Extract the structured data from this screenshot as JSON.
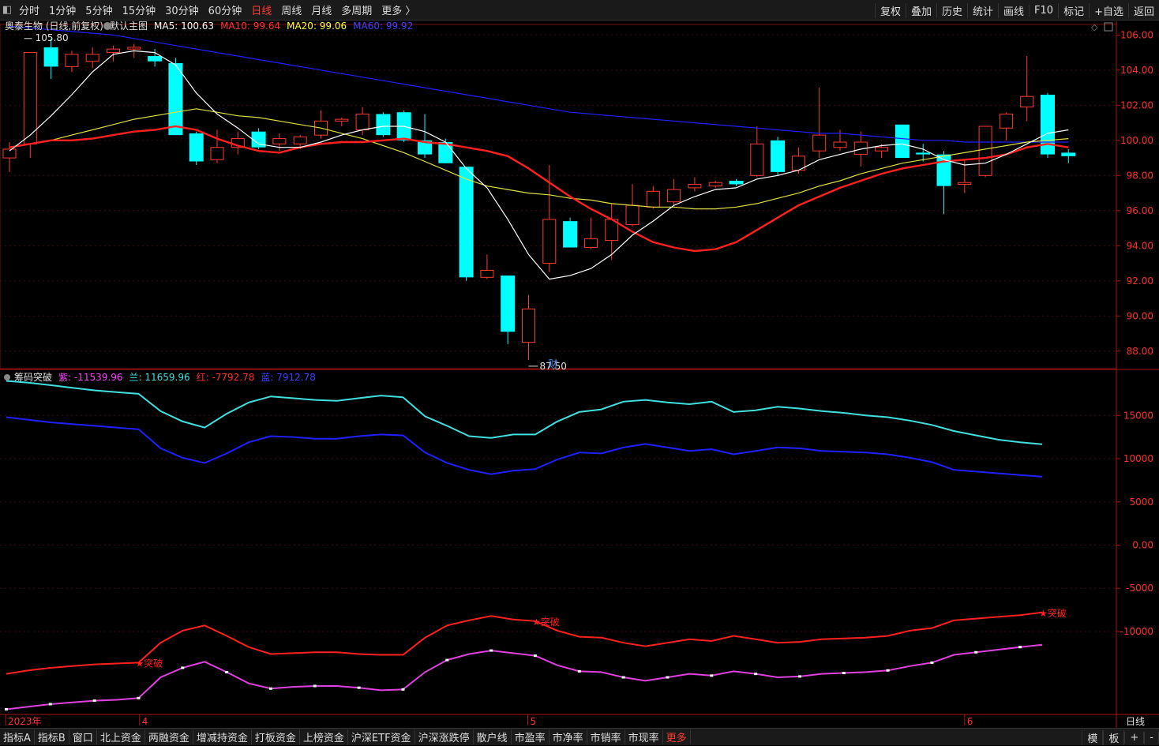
{
  "toolbar": {
    "periods": [
      "分时",
      "1分钟",
      "5分钟",
      "15分钟",
      "30分钟",
      "60分钟",
      "日线",
      "周线",
      "月线",
      "多周期",
      "更多 〉"
    ],
    "active_index": 6,
    "right_buttons": [
      "复权",
      "叠加",
      "历史",
      "统计",
      "画线",
      "F10",
      "标记",
      "+自选",
      "返回"
    ]
  },
  "main_legend": {
    "stock": "奥泰生物 (日线,前复权)",
    "template": "默认主图",
    "ma5": "MA5: 100.63",
    "ma10": "MA10: 99.64",
    "ma20": "MA20: 99.06",
    "ma60": "MA60: 99.92"
  },
  "sub_legend": {
    "name": "筹码突破",
    "purple": "紫: -11539.96",
    "blue": "兰: 11659.96",
    "red": "红: -7792.78",
    "darkblue": "蓝: 7912.78"
  },
  "annotations": {
    "high": "105.80",
    "low": "87.50",
    "cai": "财",
    "breakout": "★突破"
  },
  "time_axis": {
    "year": "2023年",
    "m4": "4",
    "m5": "5",
    "m6": "6",
    "period": "日线"
  },
  "colors": {
    "up": "#ff3b30",
    "down": "#00ffff",
    "ma5": "#ffffff",
    "ma10": "#ff2020",
    "ma20": "#e0e040",
    "ma60": "#2020ff"
  },
  "bottom_tabs": [
    "指标A",
    "指标B",
    "窗口",
    "北上资金",
    "两融资金",
    "增减持资金",
    "打板资金",
    "上榜资金",
    "沪深ETF资金",
    "沪深涨跌停",
    "散户线",
    "市盈率",
    "市净率",
    "市销率",
    "市现率",
    "更多"
  ],
  "bottom_right": [
    "模",
    "板",
    "+",
    "-"
  ],
  "chart_data": [
    {
      "type": "candlestick",
      "title": "奥泰生物 (日线,前复权)",
      "y_ticks": [
        106,
        104,
        102,
        100,
        98,
        96,
        94,
        92,
        90,
        88
      ],
      "ylim": [
        87.0,
        106.6
      ],
      "candles": [
        {
          "o": 99.0,
          "h": 99.9,
          "l": 98.2,
          "c": 99.5
        },
        {
          "o": 99.8,
          "h": 105.0,
          "l": 99.0,
          "c": 105.0
        },
        {
          "o": 105.3,
          "h": 105.8,
          "l": 103.5,
          "c": 104.2
        },
        {
          "o": 104.2,
          "h": 105.1,
          "l": 103.9,
          "c": 104.9
        },
        {
          "o": 104.5,
          "h": 105.3,
          "l": 104.1,
          "c": 104.9
        },
        {
          "o": 105.0,
          "h": 105.4,
          "l": 104.5,
          "c": 105.2
        },
        {
          "o": 105.2,
          "h": 105.5,
          "l": 104.7,
          "c": 105.3
        },
        {
          "o": 104.8,
          "h": 105.2,
          "l": 104.2,
          "c": 104.5
        },
        {
          "o": 104.4,
          "h": 104.7,
          "l": 100.3,
          "c": 100.3
        },
        {
          "o": 100.4,
          "h": 100.5,
          "l": 98.6,
          "c": 98.8
        },
        {
          "o": 98.9,
          "h": 100.6,
          "l": 98.7,
          "c": 99.6
        },
        {
          "o": 99.6,
          "h": 100.5,
          "l": 99.2,
          "c": 100.1
        },
        {
          "o": 100.5,
          "h": 100.7,
          "l": 99.5,
          "c": 99.6
        },
        {
          "o": 99.8,
          "h": 100.4,
          "l": 99.4,
          "c": 100.1
        },
        {
          "o": 99.8,
          "h": 100.3,
          "l": 99.5,
          "c": 100.2
        },
        {
          "o": 100.3,
          "h": 101.7,
          "l": 100.1,
          "c": 101.1
        },
        {
          "o": 101.1,
          "h": 101.3,
          "l": 100.8,
          "c": 101.2
        },
        {
          "o": 100.6,
          "h": 101.9,
          "l": 100.3,
          "c": 101.5
        },
        {
          "o": 101.5,
          "h": 101.6,
          "l": 100.2,
          "c": 100.3
        },
        {
          "o": 101.6,
          "h": 101.7,
          "l": 99.9,
          "c": 100.0
        },
        {
          "o": 100.0,
          "h": 101.5,
          "l": 99.0,
          "c": 99.2
        },
        {
          "o": 99.9,
          "h": 100.1,
          "l": 98.7,
          "c": 98.7
        },
        {
          "o": 98.5,
          "h": 98.5,
          "l": 92.0,
          "c": 92.2
        },
        {
          "o": 92.2,
          "h": 93.5,
          "l": 92.1,
          "c": 92.6
        },
        {
          "o": 92.3,
          "h": 92.3,
          "l": 88.4,
          "c": 89.1
        },
        {
          "o": 88.5,
          "h": 91.2,
          "l": 87.5,
          "c": 90.4
        },
        {
          "o": 93.0,
          "h": 98.6,
          "l": 92.5,
          "c": 95.5
        },
        {
          "o": 95.4,
          "h": 95.6,
          "l": 93.9,
          "c": 93.9
        },
        {
          "o": 93.9,
          "h": 95.6,
          "l": 93.8,
          "c": 94.4
        },
        {
          "o": 94.3,
          "h": 96.4,
          "l": 93.2,
          "c": 95.5
        },
        {
          "o": 95.2,
          "h": 97.5,
          "l": 95.1,
          "c": 96.3
        },
        {
          "o": 96.2,
          "h": 97.4,
          "l": 96.1,
          "c": 97.1
        },
        {
          "o": 96.5,
          "h": 97.8,
          "l": 96.3,
          "c": 97.2
        },
        {
          "o": 97.3,
          "h": 97.9,
          "l": 97.1,
          "c": 97.5
        },
        {
          "o": 97.4,
          "h": 97.7,
          "l": 97.3,
          "c": 97.6
        },
        {
          "o": 97.7,
          "h": 97.8,
          "l": 97.4,
          "c": 97.5
        },
        {
          "o": 98.0,
          "h": 100.8,
          "l": 97.9,
          "c": 99.8
        },
        {
          "o": 100.0,
          "h": 100.2,
          "l": 98.0,
          "c": 98.2
        },
        {
          "o": 98.3,
          "h": 99.6,
          "l": 98.1,
          "c": 99.1
        },
        {
          "o": 99.4,
          "h": 103.0,
          "l": 99.0,
          "c": 100.3
        },
        {
          "o": 99.6,
          "h": 100.6,
          "l": 99.4,
          "c": 99.9
        },
        {
          "o": 99.2,
          "h": 100.5,
          "l": 98.5,
          "c": 99.9
        },
        {
          "o": 99.4,
          "h": 99.8,
          "l": 99.0,
          "c": 99.6
        },
        {
          "o": 100.9,
          "h": 100.9,
          "l": 99.0,
          "c": 99.0
        },
        {
          "o": 99.3,
          "h": 99.8,
          "l": 98.8,
          "c": 99.2
        },
        {
          "o": 99.2,
          "h": 99.4,
          "l": 95.8,
          "c": 97.4
        },
        {
          "o": 97.5,
          "h": 98.9,
          "l": 97.0,
          "c": 97.6
        },
        {
          "o": 98.0,
          "h": 100.8,
          "l": 97.9,
          "c": 100.8
        },
        {
          "o": 100.7,
          "h": 101.6,
          "l": 100.0,
          "c": 101.5
        },
        {
          "o": 101.9,
          "h": 104.8,
          "l": 101.1,
          "c": 102.5
        },
        {
          "o": 102.6,
          "h": 102.7,
          "l": 99.0,
          "c": 99.2
        },
        {
          "o": 99.3,
          "h": 99.5,
          "l": 98.7,
          "c": 99.1
        }
      ],
      "ma5": [
        99.4,
        100.3,
        101.4,
        102.6,
        103.9,
        104.9,
        105.1,
        105.0,
        104.3,
        102.7,
        101.5,
        100.7,
        99.8,
        99.6,
        99.6,
        99.9,
        100.3,
        100.6,
        100.8,
        100.8,
        100.5,
        99.9,
        98.4,
        97.3,
        95.5,
        93.5,
        92.1,
        92.3,
        92.7,
        93.5,
        94.6,
        95.4,
        96.3,
        96.8,
        97.2,
        97.3,
        97.8,
        98.0,
        98.3,
        98.9,
        99.2,
        99.5,
        99.7,
        99.8,
        99.5,
        98.9,
        98.6,
        98.7,
        99.2,
        99.8,
        100.4,
        100.6
      ],
      "ma10": [
        99.6,
        99.8,
        100.0,
        100.0,
        100.1,
        100.3,
        100.5,
        100.6,
        100.8,
        100.6,
        100.1,
        99.7,
        99.4,
        99.3,
        99.6,
        99.8,
        99.9,
        99.9,
        100.0,
        100.1,
        99.9,
        99.8,
        99.6,
        99.4,
        99.1,
        98.4,
        97.6,
        96.8,
        96.1,
        95.5,
        94.8,
        94.2,
        93.9,
        93.7,
        93.8,
        94.2,
        94.9,
        95.6,
        96.3,
        96.8,
        97.3,
        97.7,
        98.1,
        98.4,
        98.6,
        98.8,
        98.9,
        99.0,
        99.2,
        99.6,
        99.8,
        99.6
      ],
      "ma20": [
        99.6,
        99.8,
        100.0,
        100.3,
        100.6,
        100.9,
        101.2,
        101.4,
        101.6,
        101.8,
        101.6,
        101.4,
        101.3,
        101.1,
        100.9,
        100.7,
        100.4,
        100.1,
        99.7,
        99.3,
        98.8,
        98.3,
        97.8,
        97.4,
        97.2,
        97.0,
        96.9,
        96.7,
        96.6,
        96.4,
        96.3,
        96.2,
        96.2,
        96.1,
        96.1,
        96.2,
        96.4,
        96.7,
        97.0,
        97.4,
        97.7,
        98.1,
        98.4,
        98.7,
        98.9,
        99.1,
        99.3,
        99.5,
        99.7,
        99.9,
        100.0,
        100.1
      ],
      "ma60": [
        106.5,
        106.4,
        106.3,
        106.2,
        106.1,
        106.0,
        105.8,
        105.6,
        105.4,
        105.2,
        105.0,
        104.8,
        104.6,
        104.4,
        104.2,
        104.0,
        103.8,
        103.6,
        103.4,
        103.2,
        103.0,
        102.8,
        102.6,
        102.4,
        102.2,
        102.0,
        101.8,
        101.6,
        101.5,
        101.4,
        101.3,
        101.2,
        101.1,
        101.0,
        100.9,
        100.8,
        100.7,
        100.6,
        100.5,
        100.4,
        100.4,
        100.3,
        100.2,
        100.1,
        100.0,
        100.0,
        99.9,
        99.9,
        99.9,
        99.9,
        99.9,
        99.9
      ]
    },
    {
      "type": "line",
      "title": "筹码突破",
      "y_ticks": [
        15000,
        10000,
        5000,
        0,
        -5000,
        -10000
      ],
      "y_tick_labels": [
        "15000",
        "10000",
        "5000",
        "0.00",
        "-5000",
        "-10000"
      ],
      "ylim": [
        -19500,
        19500
      ],
      "series": [
        {
          "name": "兰",
          "color": "#40e0e0",
          "values": [
            19000,
            18800,
            18500,
            18200,
            17900,
            17700,
            17500,
            15500,
            14300,
            13600,
            15200,
            16500,
            17200,
            17000,
            16800,
            16700,
            17000,
            17300,
            17100,
            14900,
            13800,
            12600,
            12400,
            12800,
            12800,
            14300,
            15400,
            15700,
            16600,
            16800,
            16500,
            16300,
            16600,
            15400,
            15600,
            16000,
            15800,
            15500,
            15300,
            15000,
            14800,
            14400,
            13900,
            13200,
            12700,
            12200,
            11900,
            11660
          ]
        },
        {
          "name": "蓝",
          "color": "#2020ff",
          "values": [
            14800,
            14500,
            14200,
            14000,
            13800,
            13600,
            13400,
            11200,
            10100,
            9500,
            10600,
            11900,
            12600,
            12500,
            12300,
            12300,
            12600,
            12800,
            12700,
            10700,
            9500,
            8700,
            8200,
            8600,
            8800,
            9900,
            10700,
            10600,
            11300,
            11700,
            11300,
            10900,
            11100,
            10500,
            10900,
            11300,
            11200,
            10900,
            10800,
            10700,
            10500,
            10100,
            9600,
            8700,
            8500,
            8300,
            8100,
            7913
          ]
        },
        {
          "name": "红",
          "color": "#ff2020",
          "values": [
            -14900,
            -14500,
            -14200,
            -14000,
            -13800,
            -13700,
            -13600,
            -11300,
            -9900,
            -9300,
            -10500,
            -11800,
            -12600,
            -12500,
            -12400,
            -12400,
            -12600,
            -12700,
            -12700,
            -10700,
            -9300,
            -8700,
            -8200,
            -8600,
            -8800,
            -9900,
            -10600,
            -10700,
            -11300,
            -11700,
            -11300,
            -10900,
            -11100,
            -10500,
            -10900,
            -11300,
            -11200,
            -10900,
            -10800,
            -10700,
            -10500,
            -9900,
            -9600,
            -8700,
            -8500,
            -8300,
            -8100,
            -7793
          ]
        },
        {
          "name": "紫",
          "color": "#e040e0",
          "values": [
            -19000,
            -18700,
            -18400,
            -18200,
            -18000,
            -17900,
            -17700,
            -15300,
            -14200,
            -13500,
            -14700,
            -16000,
            -16600,
            -16400,
            -16300,
            -16300,
            -16500,
            -16800,
            -16700,
            -14700,
            -13300,
            -12600,
            -12200,
            -12500,
            -12800,
            -13900,
            -14600,
            -14700,
            -15300,
            -15700,
            -15300,
            -14900,
            -15100,
            -14600,
            -14900,
            -15300,
            -15200,
            -14900,
            -14800,
            -14700,
            -14500,
            -14000,
            -13600,
            -12700,
            -12400,
            -12100,
            -11800,
            -11540
          ]
        }
      ],
      "markers": [
        {
          "label": "★突破",
          "series": "红",
          "index": 6
        },
        {
          "label": "★突破",
          "series": "红",
          "index": 24
        },
        {
          "label": "★突破",
          "series": "红",
          "index": 47
        }
      ]
    }
  ]
}
